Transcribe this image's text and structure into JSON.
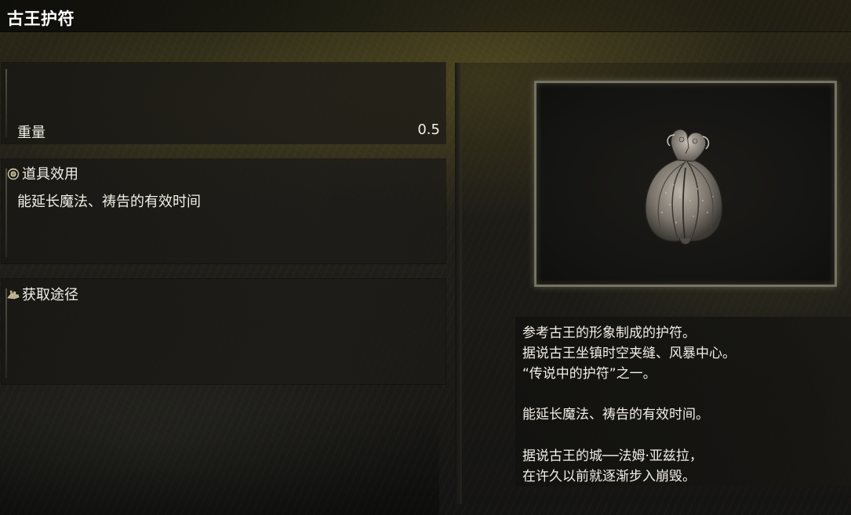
{
  "item": {
    "name": "古王护符"
  },
  "stats": {
    "weight_label": "重量",
    "weight_value": "0.5"
  },
  "effect": {
    "heading": "道具效用",
    "text": "能延长魔法、祷告的有效时间"
  },
  "source": {
    "heading": "获取途径"
  },
  "description": {
    "lines": [
      "参考古王的形象制成的护符。",
      "据说古王坐镇时空夹缝、风暴中心。",
      "“传说中的护符”之一。",
      "",
      "能延长魔法、祷告的有效时间。",
      "",
      "据说古王的城──法姆·亚兹拉，",
      "在许久以前就逐渐步入崩毁。"
    ]
  },
  "icons": {
    "effect": "eye-icon",
    "source": "hand-icon",
    "item_image": "talisman-image"
  }
}
